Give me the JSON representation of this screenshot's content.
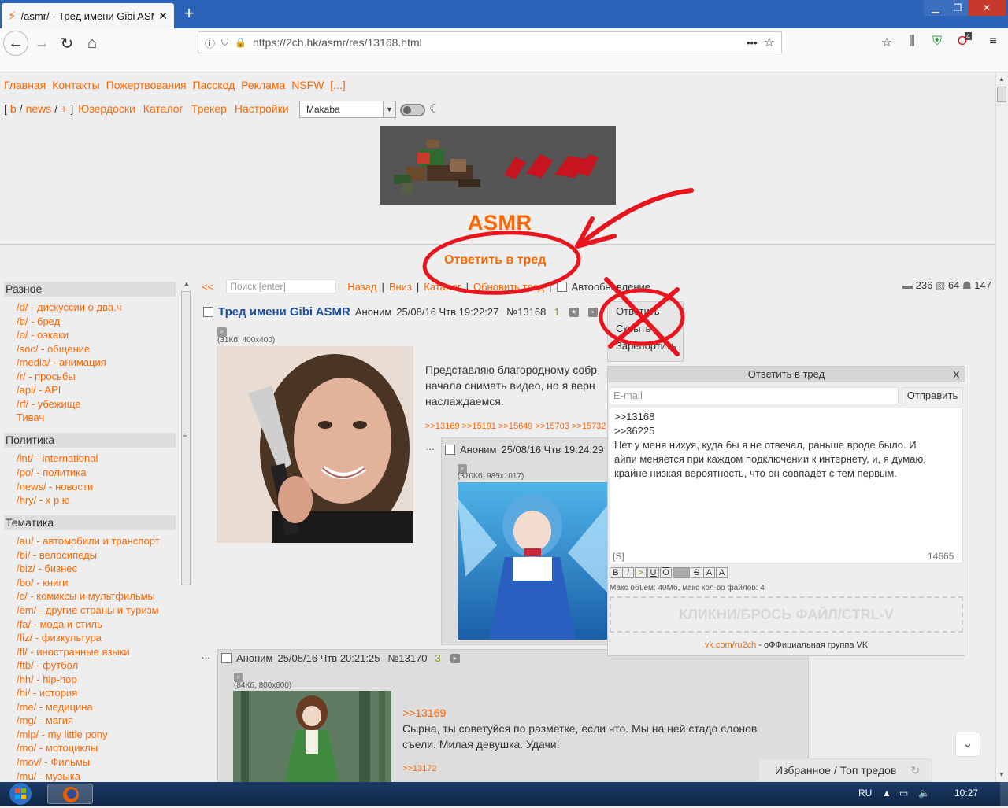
{
  "browser": {
    "tab_title": "/asmr/ - Тред имени Gibi ASMR",
    "url": "https://2ch.hk/asmr/res/13168.html",
    "badge_count": "4"
  },
  "site": {
    "topnav": [
      "Главная",
      "Контакты",
      "Пожертвования",
      "Пасскод",
      "Реклама",
      "NSFW",
      "[...]"
    ],
    "boardnav": {
      "open": "[",
      "b": "b",
      "sep1": "/",
      "news": "news",
      "sep2": "/",
      "plus": "+",
      "close": "]",
      "userboards": "Юзердоски",
      "catalog": "Каталог",
      "tracker": "Трекер",
      "settings": "Настройки"
    },
    "style_select": "Makaba",
    "board_title": "ASMR",
    "reply_in_thread": "Ответить в тред"
  },
  "sidebar": {
    "sections": [
      {
        "title": "Разное",
        "items": [
          "/d/ - дискуссии о два.ч",
          "/b/ - бред",
          "/o/ - оэкаки",
          "/soc/ - общение",
          "/media/ - анимация",
          "/r/ - просьбы",
          "/api/ - API",
          "/rf/ - убежище",
          "Тивач"
        ]
      },
      {
        "title": "Политика",
        "items": [
          "/int/ - international",
          "/po/ - политика",
          "/news/ - новости",
          "/hry/ - х р ю"
        ]
      },
      {
        "title": "Тематика",
        "items": [
          "/au/ - автомобили и транспорт",
          "/bi/ - велосипеды",
          "/biz/ - бизнес",
          "/bo/ - книги",
          "/c/ - комиксы и мультфильмы",
          "/em/ - другие страны и туризм",
          "/fa/ - мода и стиль",
          "/fiz/ - физкультура",
          "/fl/ - иностранные языки",
          "/ftb/ - футбол",
          "/hh/ - hip-hop",
          "/hi/ - история",
          "/me/ - медицина",
          "/mg/ - магия",
          "/mlp/ - my little pony",
          "/mo/ - мотоциклы",
          "/mov/ - Фильмы",
          "/mu/ - музыка"
        ]
      }
    ]
  },
  "threadbar": {
    "back_arrows": "<<",
    "search_placeholder": "Поиск [enter]",
    "back": "Назад",
    "down": "Вниз",
    "catalog": "Каталог",
    "refresh": "Обновить тред",
    "autorefresh": "Автообновление",
    "sep": "|",
    "stats": {
      "posts": "236",
      "images": "64",
      "users": "147"
    }
  },
  "op": {
    "subject": "Тред имени Gibi ASMR",
    "author": "Аноним",
    "date": "25/08/16 Чтв 19:22:27",
    "num": "№13168",
    "index": "1",
    "fileinfo": "(31Кб, 400x400)",
    "text": "Представляю благородному собр начала снимать видео, но я верн наслаждаемся.",
    "text_lines": [
      "Представляю благородному собр",
      "начала снимать видео, но я верн",
      "наслаждаемся."
    ],
    "replies": ">>13169 >>15191 >>15649 >>15703 >>15732"
  },
  "reply1": {
    "dots": "...",
    "author": "Аноним",
    "date": "25/08/16 Чтв 19:24:29",
    "fileinfo": "(310Кб, 985x1017)"
  },
  "reply2": {
    "dots": "...",
    "author": "Аноним",
    "date": "25/08/16 Чтв 20:21:25",
    "num": "№13170",
    "index": "3",
    "fileinfo": "(84Кб, 800x600)",
    "quote": ">>13169",
    "text_lines": [
      "Сырна, ты советуйся по разметке, если что. Мы на ней стадо слонов",
      "съели. Милая девушка. Удачи!"
    ],
    "replies": ">>13172"
  },
  "menu": {
    "items": [
      "Ответить",
      "Скрыть",
      "Зарепортить"
    ]
  },
  "quickreply": {
    "title": "Ответить в тред",
    "close": "X",
    "email_placeholder": "E-mail",
    "send": "Отправить",
    "text_lines": [
      ">>13168",
      ">>36225",
      "Нет у меня нихуя, куда бы я не отвечал, раньше вроде было. И",
      "айпи меняется при каждом подключении к интернету, и, я думаю,",
      "крайне низкая вероятность, что он совпадёт с тем первым."
    ],
    "tags": "[S]",
    "counter": "14665",
    "format_buttons": [
      "B",
      "I",
      ">",
      "U",
      "O",
      "",
      "S",
      "A",
      "A"
    ],
    "limit": "Макс объем: 40Мб, макс кол-во файлов: 4",
    "dropzone": "КЛИКНИ/БРОСЬ ФАЙЛ/CTRL-V",
    "vk_link": "vk.com/ru2ch",
    "vk_text": " - оФФициальная группа VK"
  },
  "bottom": {
    "favorites": "Избранное",
    "sep": "/",
    "top_threads": "Топ тредов"
  },
  "taskbar": {
    "lang": "RU",
    "time": "10:27"
  }
}
